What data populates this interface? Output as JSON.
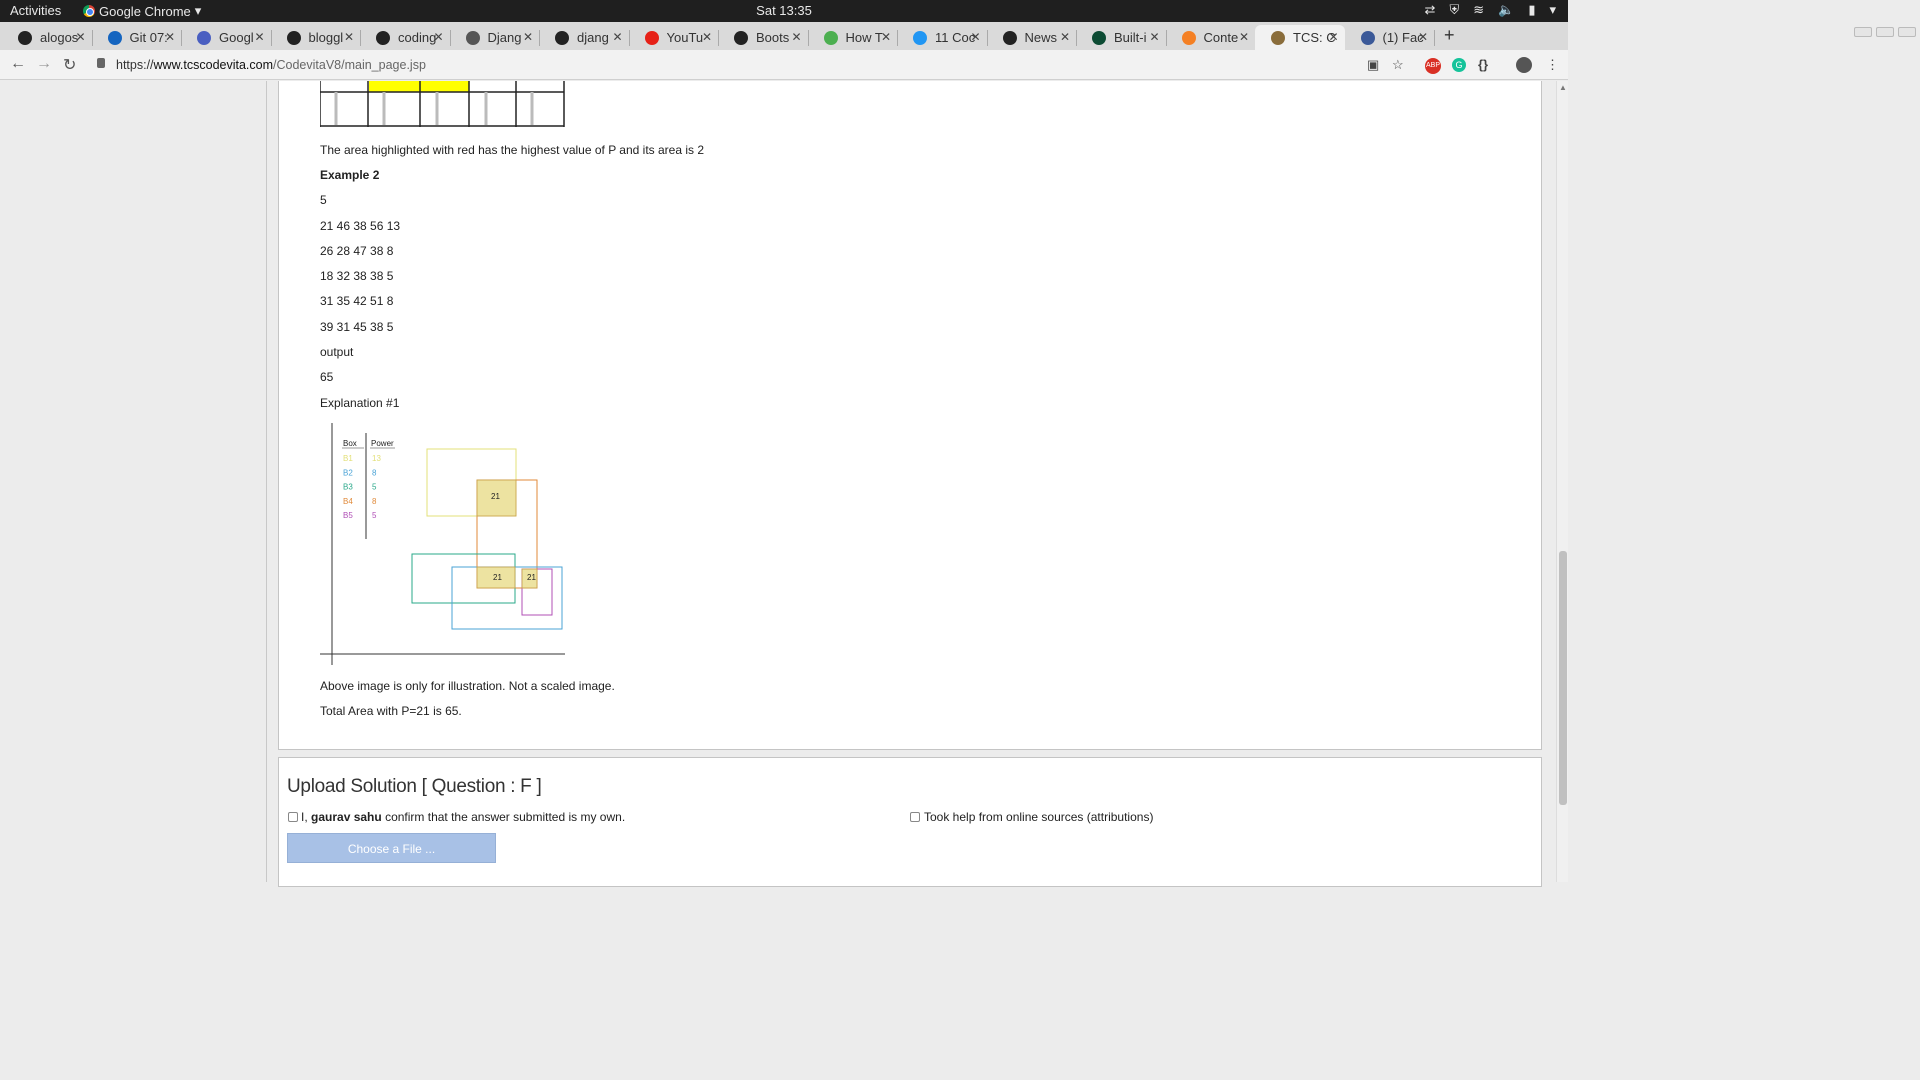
{
  "system": {
    "activities": "Activities",
    "app_name": "Google Chrome",
    "clock": "Sat 13:35"
  },
  "tabs": [
    {
      "title": "alogos",
      "icon": "github-icon"
    },
    {
      "title": "Git 07:",
      "icon": "link-icon"
    },
    {
      "title": "Googl",
      "icon": "google-icon"
    },
    {
      "title": "bloggl",
      "icon": "github-icon"
    },
    {
      "title": "coding",
      "icon": "github-icon"
    },
    {
      "title": "Djang",
      "icon": "table-icon"
    },
    {
      "title": "djang",
      "icon": "github-icon"
    },
    {
      "title": "YouTu",
      "icon": "youtube-icon"
    },
    {
      "title": "Boots",
      "icon": "bootstrap-icon"
    },
    {
      "title": "How T",
      "icon": "w3-icon"
    },
    {
      "title": "11 Coc",
      "icon": "site-icon"
    },
    {
      "title": "News",
      "icon": "codepen-icon"
    },
    {
      "title": "Built-i",
      "icon": "django-icon"
    },
    {
      "title": "Conte",
      "icon": "stack-icon"
    },
    {
      "title": "TCS: C",
      "icon": "tcs-icon",
      "active": true
    },
    {
      "title": "(1) Fac",
      "icon": "facebook-icon"
    }
  ],
  "omnibox": {
    "scheme": "https://",
    "host": "www.tcscodevita.com",
    "path": "/CodevitaV8/main_page.jsp"
  },
  "content": {
    "area_text": "The area highlighted with red has the highest value of P and its area is 2",
    "example2": "Example 2",
    "input_lines": [
      "5",
      "21 46 38 56 13",
      "26 28 47 38 8",
      "18 32 38 38 5",
      "31 35 42 51 8",
      "39 31 45 38 5"
    ],
    "output_label": "output",
    "output_value": "65",
    "explanation": "Explanation #1",
    "illus_note": "Above image is only for illustration. Not a scaled image.",
    "total_area": "Total Area with P=21 is 65."
  },
  "illustration": {
    "header_box": "Box",
    "header_power": "Power",
    "rows": [
      {
        "box": "B1",
        "power": "13",
        "color": "#e3e07a"
      },
      {
        "box": "B2",
        "power": "8",
        "color": "#4aa3d6"
      },
      {
        "box": "B3",
        "power": "5",
        "color": "#2aa88a"
      },
      {
        "box": "B4",
        "power": "8",
        "color": "#e08a3a"
      },
      {
        "box": "B5",
        "power": "5",
        "color": "#b04fb6"
      }
    ],
    "overlap_labels": [
      "21",
      "21",
      "21"
    ]
  },
  "upload": {
    "title": "Upload Solution [ Question : F ]",
    "confirm_prefix": "I,",
    "user": "gaurav sahu",
    "confirm_suffix": "confirm that the answer submitted is my own.",
    "help_label": "Took help from online sources (attributions)",
    "file_button": "Choose a File ..."
  }
}
